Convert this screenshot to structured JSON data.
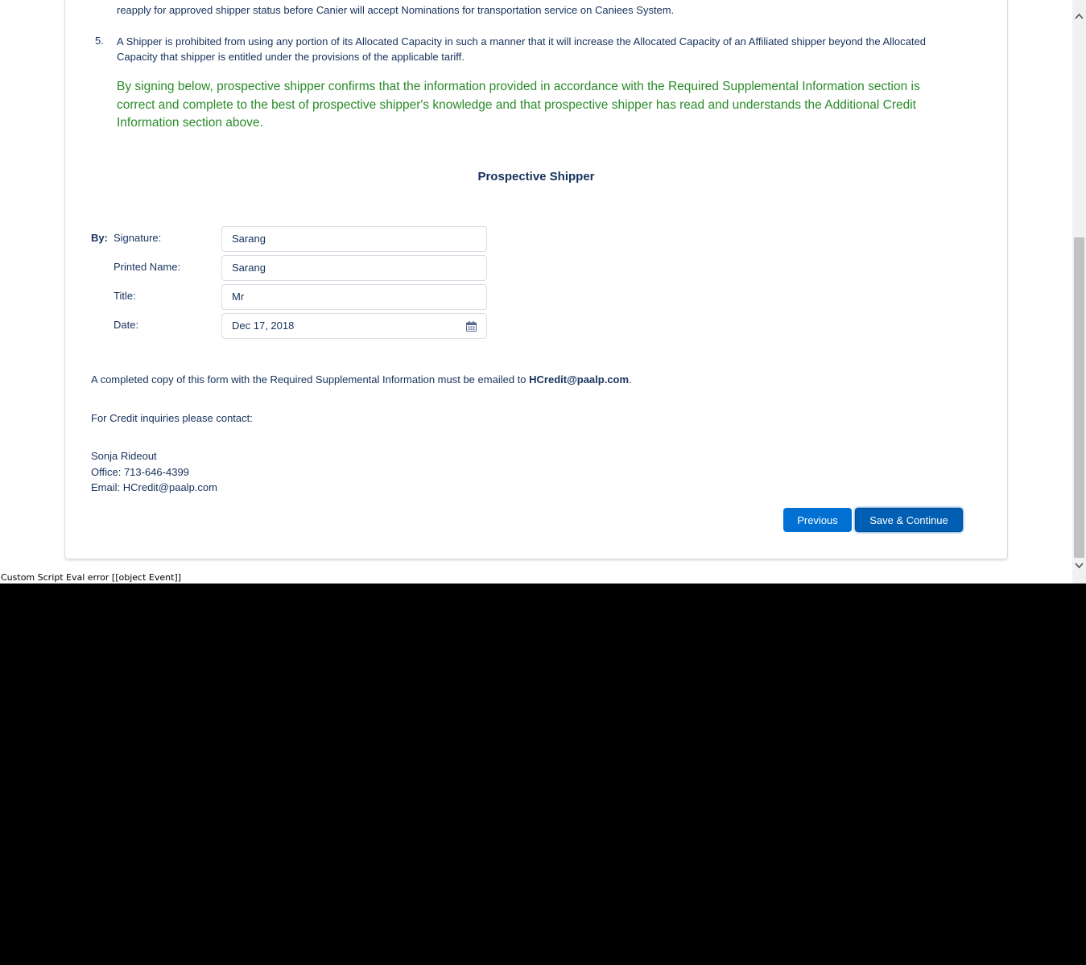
{
  "terms": {
    "clipped_line": "reapply for approved shipper status before Canier will accept Nominations for transportation service on Caniees System.",
    "item5_number": "5.",
    "item5_line1": "A Shipper is prohibited from using any portion of its Allocated Capacity in such a manner that it will increase the Allocated Capacity of an Affiliated shipper beyond the Allocated",
    "item5_line2": "Capacity that shipper is entitled under the provisions of the applicable tariff.",
    "confirmation": "By signing below, prospective shipper confirms that the information provided in accordance with the Required Supplemental Information section is correct and complete to the best of prospective shipper's knowledge and that prospective shipper has read and understands the Additional Credit Information section above.",
    "confirmation_color": "#2a8b2a"
  },
  "section_title": "Prospective Shipper",
  "signature_form": {
    "by_label": "By:",
    "signature_label": "Signature:",
    "signature_value": "Sarang",
    "printed_name_label": "Printed Name:",
    "printed_name_value": "Sarang",
    "title_label": "Title:",
    "title_value": "Mr",
    "date_label": "Date:",
    "date_value": "Dec 17, 2018"
  },
  "notice": {
    "prefix": "A completed copy of this form with the Required Supplemental Information must be emailed to ",
    "email": "HCredit@paalp.com",
    "suffix": "."
  },
  "contact": {
    "heading": "For Credit inquiries please contact:",
    "name": "Sonja Rideout",
    "office": "Office: 713-646-4399",
    "email": "Email: HCredit@paalp.com"
  },
  "buttons": {
    "previous": "Previous",
    "save_continue": "Save & Continue",
    "brand_color": "#0070d2"
  },
  "error_message": "Custom Script Eval error [[object Event]]",
  "icons": {
    "date": "calendar-icon",
    "scroll_up": "chevron-up-icon",
    "scroll_down": "chevron-down-icon"
  }
}
